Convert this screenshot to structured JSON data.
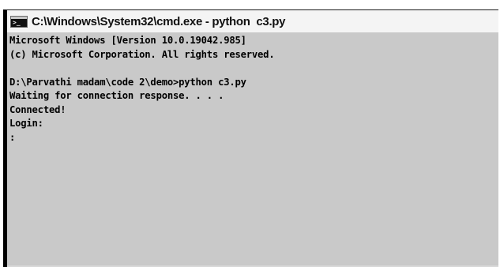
{
  "window": {
    "title": "C:\\Windows\\System32\\cmd.exe - python  c3.py",
    "icon": "cmd-console-icon",
    "icon_glyph": ">_"
  },
  "console": {
    "lines": [
      "Microsoft Windows [Version 10.0.19042.985]",
      "(c) Microsoft Corporation. All rights reserved.",
      "",
      "D:\\Parvathi madam\\code 2\\demo>python c3.py",
      "Waiting for connection response. . . .",
      "Connected!",
      "Login:",
      ":"
    ]
  },
  "colors": {
    "console_background": "#c9c9c9",
    "console_text": "#000000",
    "titlebar_background": "#f4f4f4"
  }
}
